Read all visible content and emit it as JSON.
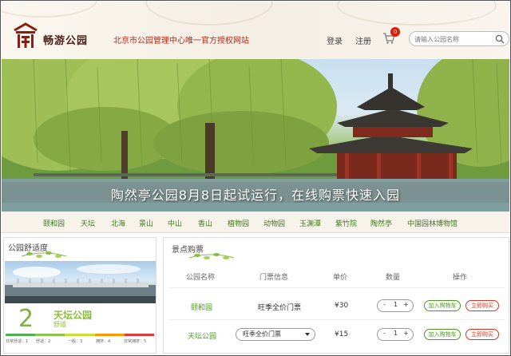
{
  "header": {
    "brand": "畅游公园",
    "slogan": "北京市公园管理中心唯一官方授权网站",
    "login": "登录",
    "register": "注册",
    "cart_count": "0",
    "search_placeholder": "请输入公园名称",
    "icons": [
      "palace-logo-icon",
      "cart-icon",
      "search-icon"
    ]
  },
  "banner": {
    "caption": "陶然亭公园8月8日起试运行，在线购票快速入园"
  },
  "nav": {
    "items": [
      "颐和园",
      "天坛",
      "北海",
      "景山",
      "中山",
      "香山",
      "植物园",
      "动物园",
      "玉渊潭",
      "紫竹院",
      "陶然亭",
      "中国园林博物馆"
    ]
  },
  "comfort": {
    "title": "公园舒适度",
    "level": "2",
    "park": "天坛公园",
    "status": "舒适",
    "labels": [
      "非常舒适：1",
      "舒适：2",
      "一般：3",
      "拥挤：4",
      "非常拥挤：5"
    ],
    "colors": [
      "#4caf50",
      "#8bc34a",
      "#cddc39",
      "#ff9800",
      "#e53935"
    ]
  },
  "tickets": {
    "title": "景点购票",
    "columns": [
      "公园名称",
      "门票信息",
      "单价",
      "数量",
      "操作"
    ],
    "rows": [
      {
        "park": "颐和园",
        "ticket": "旺季全价门票",
        "price": "¥30",
        "qty": "1",
        "add": "加入购物车",
        "buy": "立即购买"
      },
      {
        "park": "天坛公园",
        "ticket": "旺季全价门票",
        "price": "¥15",
        "qty": "1",
        "add": "加入购物车",
        "buy": "立即购买"
      }
    ],
    "minus": "-",
    "plus": "+"
  }
}
